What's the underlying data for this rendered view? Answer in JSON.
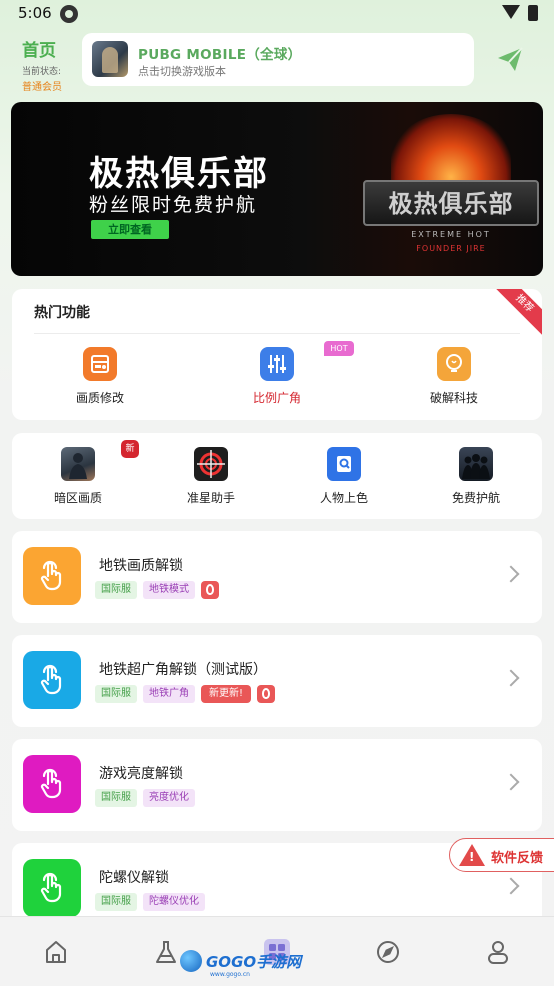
{
  "status_bar": {
    "time": "5:06"
  },
  "header": {
    "home_title": "首页",
    "status_label": "当前状态:",
    "member_level": "普通会员",
    "game_name": "PUBG MOBILE（全球）",
    "game_sub": "点击切换游戏版本"
  },
  "banner": {
    "title": "极热俱乐部",
    "subtitle": "粉丝限时免费护航",
    "button": "立即查看",
    "logo_text": "极热俱乐部",
    "logo_en1": "EXTREME HOT",
    "logo_en2": "FOUNDER JIRE"
  },
  "hot": {
    "title": "热门功能",
    "ribbon": "推荐",
    "hot_badge": "HOT",
    "items": [
      {
        "label": "画质修改",
        "icon": "quality-icon",
        "color": "#f27a2a"
      },
      {
        "label": "比例广角",
        "icon": "sliders-icon",
        "color": "#3d7ee8",
        "highlight": "#d4262f"
      },
      {
        "label": "破解科技",
        "icon": "bulb-icon",
        "color": "#f4a53a"
      }
    ]
  },
  "tools": {
    "new_badge": "新",
    "items": [
      {
        "label": "暗区画质",
        "icon": "soldier-icon"
      },
      {
        "label": "准星助手",
        "icon": "crosshair-icon"
      },
      {
        "label": "人物上色",
        "icon": "paint-icon"
      },
      {
        "label": "免费护航",
        "icon": "squad-icon"
      }
    ]
  },
  "list": [
    {
      "title": "地铁画质解锁",
      "color": "#fba532",
      "tags": [
        "国际服",
        "地铁模式"
      ],
      "new_tag": ""
    },
    {
      "title": "地铁超广角解锁（测试版）",
      "color": "#19a9e6",
      "tags": [
        "国际服",
        "地铁广角"
      ],
      "new_tag": "新更新!"
    },
    {
      "title": "游戏亮度解锁",
      "color": "#df1bc1",
      "tags": [
        "国际服",
        "亮度优化"
      ],
      "new_tag": ""
    },
    {
      "title": "陀螺仪解锁",
      "color": "#1fd23c",
      "tags": [
        "国际服",
        "陀螺仪优化"
      ],
      "new_tag": ""
    }
  ],
  "feedback": {
    "label": "软件反馈"
  },
  "watermark": {
    "text": "GOGO手游网",
    "small": "www.gogo.cn"
  },
  "nav": [
    "home-icon",
    "flask-icon",
    "apps-icon",
    "compass-icon",
    "profile-icon"
  ]
}
